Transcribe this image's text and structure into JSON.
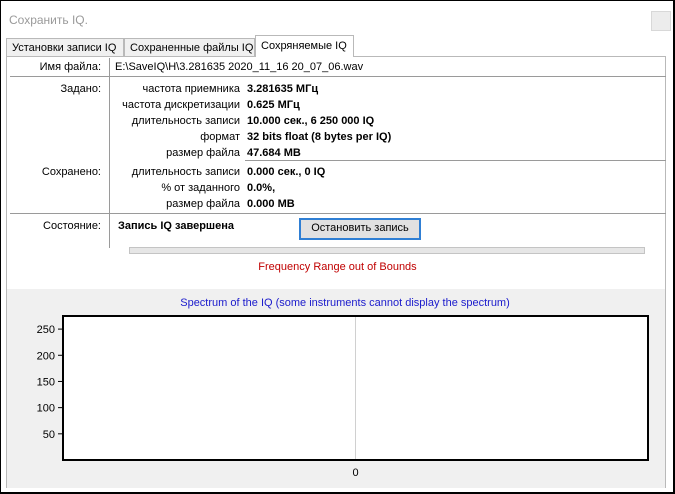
{
  "window": {
    "title": "Сохранить IQ."
  },
  "tabs": [
    {
      "label": "Установки записи IQ"
    },
    {
      "label": "Сохраненные файлы IQ"
    },
    {
      "label": "Сохряняемые IQ"
    }
  ],
  "file": {
    "label": "Имя файла:",
    "value": "E:\\SaveIQ\\H\\3.281635 2020_11_16  20_07_06.wav"
  },
  "set": {
    "label": "Задано:",
    "rows": [
      {
        "key": "частота приемника",
        "value": "3.281635 МГц"
      },
      {
        "key": "частота дискретизации",
        "value": "0.625 МГц"
      },
      {
        "key": "длительность записи",
        "value": "10.000 сек.,  6 250 000 IQ"
      },
      {
        "key": "формат",
        "value": "32 bits float (8 bytes per IQ)"
      },
      {
        "key": "размер файла",
        "value": "47.684 MB"
      }
    ]
  },
  "saved": {
    "label": "Сохранено:",
    "rows": [
      {
        "key": "длительность записи",
        "value": "0.000 сек.,  0 IQ"
      },
      {
        "key": "% от заданного",
        "value": "0.0%,"
      },
      {
        "key": "размер файла",
        "value": "0.000 MB"
      }
    ]
  },
  "state": {
    "label": "Состояние:",
    "value": "Запись IQ завершена",
    "stop_button": "Остановить запись",
    "progress": 0
  },
  "error_text": "Frequency Range out of Bounds",
  "spectrum_title": "Spectrum of the IQ (some instruments cannot display the spectrum)",
  "chart_data": {
    "type": "line",
    "title": "Spectrum of the IQ (some instruments cannot display the spectrum)",
    "y_ticks": [
      250,
      200,
      150,
      100,
      50
    ],
    "x_ticks": [
      0
    ],
    "ylim": [
      0,
      275
    ],
    "xlim": [
      -1,
      1
    ],
    "series": [],
    "grid": true
  },
  "colors": {
    "error": "#c00000",
    "spectrum_title": "#1a1acc",
    "button_border": "#2f7fd4"
  }
}
